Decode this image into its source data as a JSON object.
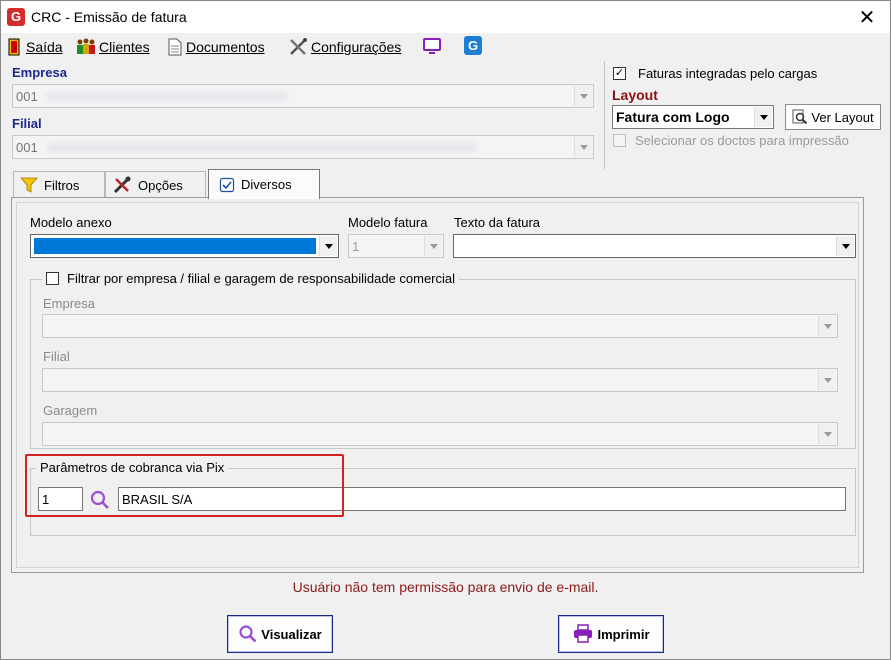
{
  "window": {
    "title": "CRC - Emissão de fatura",
    "logo_letter": "G",
    "close_glyph": "✕"
  },
  "menu": {
    "saida": "Saída",
    "clientes": "Clientes",
    "documentos": "Documentos",
    "configuracoes": "Configurações"
  },
  "header": {
    "empresa_label": "Empresa",
    "empresa_value": "001",
    "filial_label": "Filial",
    "filial_value": "001",
    "faturas_integradas_label": "Faturas integradas pelo cargas",
    "faturas_integradas_checked": true,
    "layout_label": "Layout",
    "layout_value": "Fatura com Logo",
    "ver_layout_label": "Ver Layout",
    "selecionar_doctos_label": "Selecionar os doctos para impressão",
    "selecionar_doctos_checked": false
  },
  "tabs": [
    {
      "label": "Filtros",
      "icon": "funnel-icon",
      "active": false
    },
    {
      "label": "Opções",
      "icon": "tools-icon",
      "active": false
    },
    {
      "label": "Diversos",
      "icon": "checkbox-icon",
      "active": true
    }
  ],
  "diversos": {
    "modelo_anexo_label": "Modelo anexo",
    "modelo_anexo_value": "",
    "modelo_fatura_label": "Modelo fatura",
    "modelo_fatura_value": "1",
    "texto_fatura_label": "Texto da fatura",
    "texto_fatura_value": "",
    "filtrar_label": "Filtrar por empresa / filial e garagem de responsabilidade comercial",
    "filtrar_checked": false,
    "empresa_label": "Empresa",
    "filial_label": "Filial",
    "garagem_label": "Garagem",
    "pix_group_label": "Parâmetros de cobranca via Pix",
    "pix_code": "1",
    "pix_name": "BRASIL S/A"
  },
  "status_message": "Usuário não tem permissão para envio de e-mail.",
  "buttons": {
    "visualizar": "Visualizar",
    "imprimir": "Imprimir"
  },
  "colors": {
    "accent_blue": "#1a2a8c",
    "layout_red": "#8b1010",
    "highlight_red": "#d32222",
    "selection_blue": "#0078d7"
  }
}
